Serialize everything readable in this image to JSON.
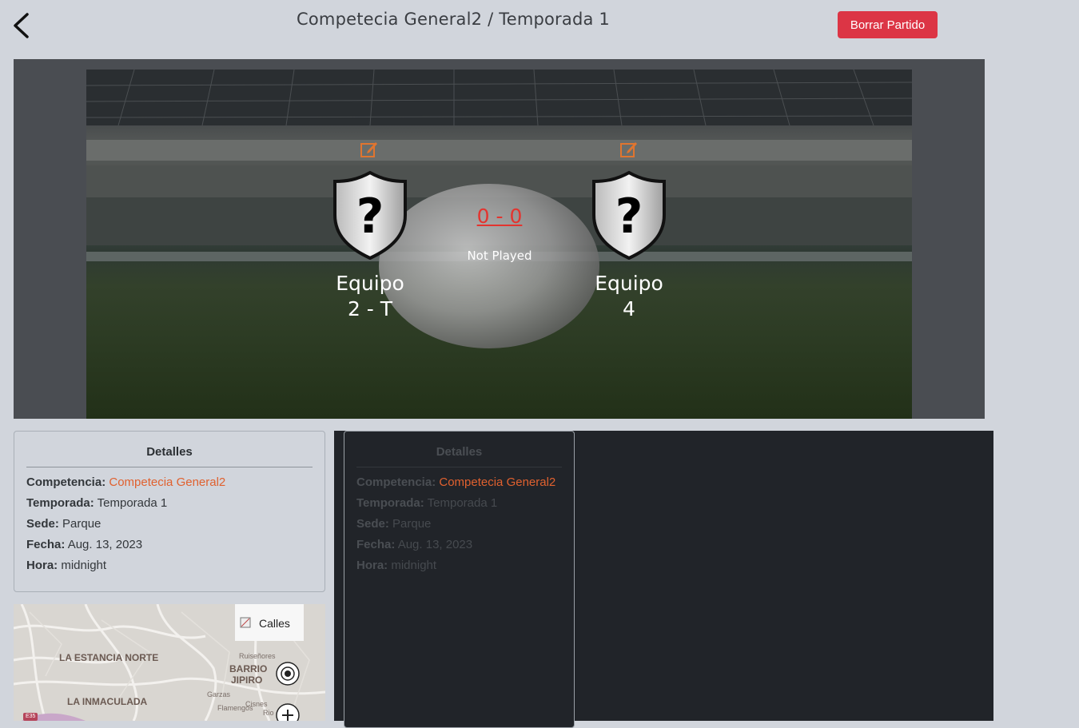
{
  "header": {
    "title": "Competecia General2 / Temporada 1",
    "delete_label": "Borrar Partido"
  },
  "match": {
    "home_team": {
      "line1": "Equipo",
      "line2": "2 - T"
    },
    "away_team": {
      "line1": "Equipo",
      "line2": "4"
    },
    "score": "0 - 0",
    "status": "Not Played"
  },
  "details": {
    "heading": "Detalles",
    "competition_label": "Competencia:",
    "competition_value": "Competecia General2",
    "season_label": "Temporada:",
    "season_value": "Temporada 1",
    "venue_label": "Sede:",
    "venue_value": "Parque",
    "date_label": "Fecha:",
    "date_value": "Aug. 13, 2023",
    "time_label": "Hora:",
    "time_value": "midnight"
  },
  "map": {
    "layer_label": "Calles",
    "labels": [
      "LA ESTANCIA NORTE",
      "BARRIO",
      "JIPIRO",
      "LA INMACULADA",
      "Ruiseñores",
      "Garzas",
      "Flamengos",
      "Cisnes",
      "Rio",
      "E35"
    ]
  },
  "colors": {
    "accent": "#e0612f",
    "danger": "#dc3545",
    "score": "#e3342f",
    "page_bg": "#d1d5dc",
    "dark_panel": "#212429"
  },
  "icons": [
    "back-chevron-icon",
    "edit-icon",
    "team-crest-icon",
    "broken-image-icon",
    "locate-icon",
    "zoom-in-icon"
  ]
}
